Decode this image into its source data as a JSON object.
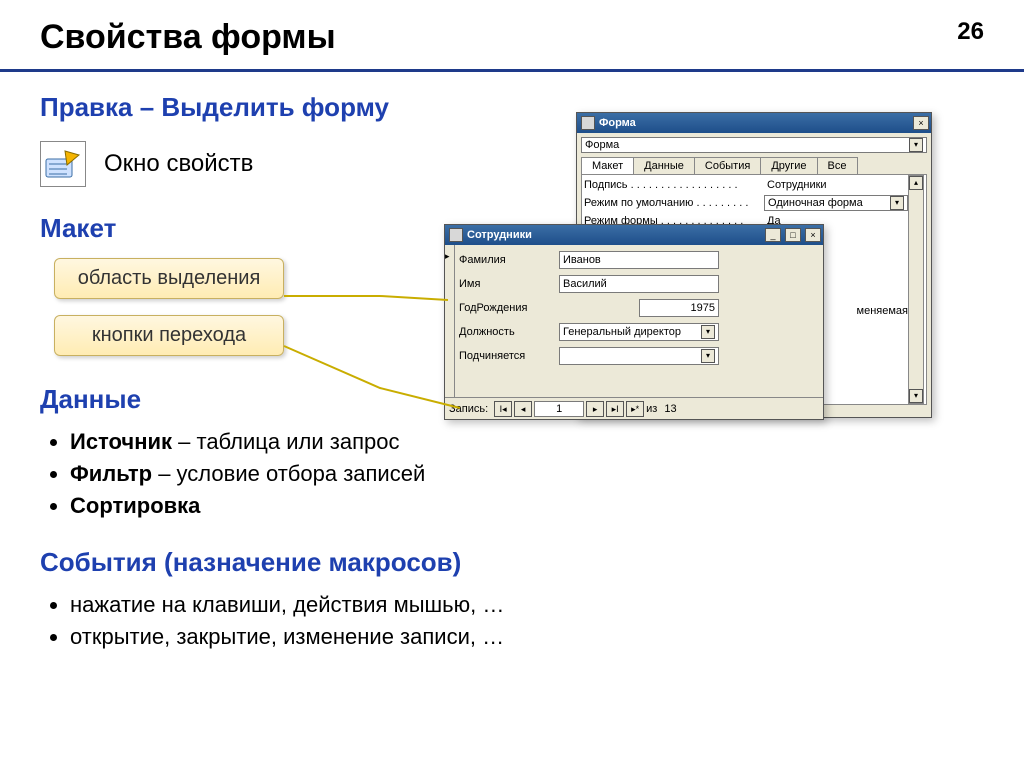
{
  "page_number": "26",
  "title": "Свойства формы",
  "subtitle": "Правка – Выделить форму",
  "icon_label": "Окно свойств",
  "sections": {
    "layout": "Макет",
    "data": "Данные",
    "events": "События (назначение макросов)"
  },
  "callouts": {
    "selector": "область выделения",
    "nav": "кнопки перехода"
  },
  "data_bullets": [
    {
      "b": "Источник",
      "rest": " – таблица или запрос"
    },
    {
      "b": "Фильтр",
      "rest": " – условие отбора записей"
    },
    {
      "b": "Сортировка",
      "rest": ""
    }
  ],
  "event_bullets": [
    "нажатие на клавиши, действия мышью, …",
    "открытие, закрытие, изменение записи, …"
  ],
  "prop_window": {
    "title": "Форма",
    "object_selector": "Форма",
    "tabs": [
      "Макет",
      "Данные",
      "События",
      "Другие",
      "Все"
    ],
    "rows": [
      {
        "label": "Подпись . . . . . . . . . . . . . . . . . .",
        "value": "Сотрудники",
        "combo": false
      },
      {
        "label": "Режим по умолчанию . . . . . . . . .",
        "value": "Одиночная форма",
        "combo": true
      },
      {
        "label": "Режим формы . . . . . . . . . . . . . .",
        "value": "Да",
        "combo": false
      }
    ],
    "truncated_value": "меняемая"
  },
  "emp_window": {
    "title": "Сотрудники",
    "fields": {
      "surname": {
        "label": "Фамилия",
        "value": "Иванов"
      },
      "name": {
        "label": "Имя",
        "value": "Василий"
      },
      "year": {
        "label": "ГодРождения",
        "value": "1975"
      },
      "position": {
        "label": "Должность",
        "value": "Генеральный директор"
      },
      "reports": {
        "label": "Подчиняется",
        "value": ""
      }
    },
    "nav": {
      "label": "Запись:",
      "current": "1",
      "of_label": "из",
      "total": "13"
    }
  }
}
